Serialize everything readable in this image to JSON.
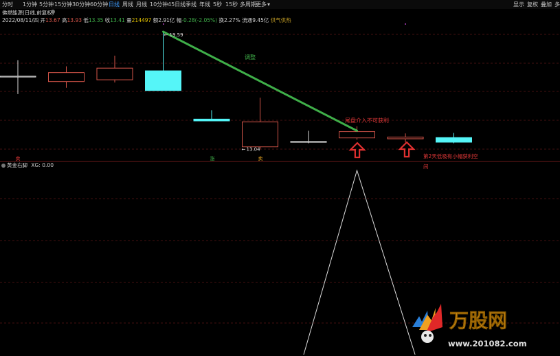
{
  "toolbar": {
    "periods": [
      {
        "label": "分时",
        "x": 3
      },
      {
        "label": "1分钟",
        "x": 33
      },
      {
        "label": "5分钟",
        "x": 57
      },
      {
        "label": "15分钟",
        "x": 79
      },
      {
        "label": "30分钟",
        "x": 105
      },
      {
        "label": "60分钟",
        "x": 131
      },
      {
        "label": "日线",
        "x": 158
      },
      {
        "label": "周线",
        "x": 178
      },
      {
        "label": "月线",
        "x": 198
      },
      {
        "label": "10分钟",
        "x": 218
      },
      {
        "label": "45日线",
        "x": 244
      },
      {
        "label": "季线",
        "x": 270
      },
      {
        "label": "年线",
        "x": 290
      },
      {
        "label": "5秒",
        "x": 310
      },
      {
        "label": "15秒",
        "x": 328
      },
      {
        "label": "多周期",
        "x": 349
      },
      {
        "label": "更多",
        "x": 372
      }
    ],
    "active_period": "日线",
    "dropdown_glyph": "▾",
    "right_items": [
      {
        "label": "显示",
        "x": 747
      },
      {
        "label": "复权",
        "x": 767
      },
      {
        "label": "叠加",
        "x": 787
      },
      {
        "label": "多",
        "x": 807
      }
    ]
  },
  "stock": {
    "name": "佛燃能源(日线,前复权)",
    "date": "2022/08/11/四",
    "open_label": "开",
    "open": "13.67",
    "high_label": "高",
    "high": "13.93",
    "low_label": "低",
    "low": "13.35",
    "close_label": "收",
    "close": "13.41",
    "volume_label": "量",
    "volume": "214497",
    "amount_label": "额",
    "amount": "2.91亿",
    "change_label": "幅",
    "change": "-0.28(-2.05%)",
    "turnover_label": "换",
    "turnover": "2.27%",
    "float_label": "流通",
    "float": "9.45亿",
    "concept": "供气供热"
  },
  "chart_data": {
    "type": "candlestick",
    "ylim": [
      12.6,
      19.9
    ],
    "candles": [
      {
        "o": 17.1,
        "h": 18.0,
        "l": 16.1,
        "c": 17.1,
        "color": "#dcdcdc",
        "fill": "none"
      },
      {
        "o": 16.8,
        "h": 17.65,
        "l": 16.45,
        "c": 17.3,
        "color": "#d8564a",
        "fill": "none"
      },
      {
        "o": 16.9,
        "h": 18.25,
        "l": 16.75,
        "c": 17.55,
        "color": "#d8564a",
        "fill": "none"
      },
      {
        "o": 17.4,
        "h": 19.59,
        "l": 16.3,
        "c": 16.3,
        "color": "#55f5f8",
        "fill": "#55f5f8"
      },
      {
        "o": 14.7,
        "h": 15.2,
        "l": 14.6,
        "c": 14.6,
        "color": "#55f5f8",
        "fill": "#55f5f8"
      },
      {
        "o": 13.15,
        "h": 15.9,
        "l": 13.04,
        "c": 14.55,
        "color": "#d8564a",
        "fill": "none"
      },
      {
        "o": 13.45,
        "h": 14.05,
        "l": 13.35,
        "c": 13.45,
        "color": "#dcdcdc",
        "fill": "none"
      },
      {
        "o": 13.65,
        "h": 14.3,
        "l": 13.55,
        "c": 14.0,
        "color": "#d8564a",
        "fill": "none"
      },
      {
        "o": 13.6,
        "h": 13.9,
        "l": 13.4,
        "c": 13.7,
        "color": "#d8564a",
        "fill": "none"
      },
      {
        "o": 13.67,
        "h": 13.93,
        "l": 13.35,
        "c": 13.41,
        "color": "#55f5f8",
        "fill": "#55f5f8"
      }
    ],
    "high_marker": "19.59",
    "low_marker": "13.04",
    "arrow_glyph": "←",
    "trend_line": {
      "from_candle": 3,
      "from_value": 19.59,
      "to_candle": 7,
      "to_value": 14.05,
      "color": "#3fae49"
    },
    "annotations": {
      "trend_note": "调整",
      "tail_note": "尾盘介入不可获利",
      "second_day_note_line1": "第2天低吸有小幅获利空",
      "second_day_note_line2": "间"
    },
    "signals": {
      "sell_1": "卖",
      "sell_2": "卖",
      "up": "涨"
    },
    "indicator": {
      "name": "黄金右脚",
      "label": "XG",
      "value": "0.00",
      "ylim": [
        0,
        1
      ],
      "peak_candle": 7,
      "peak_value": 1,
      "base_candles": [
        5.9,
        8.2
      ]
    }
  },
  "watermark": {
    "brand": "万股网",
    "url": "www.201082.com"
  },
  "colors": {
    "background": "#000000",
    "up": "#d8564a",
    "down": "#55f5f8",
    "annotation_red": "#e03838",
    "annotation_green": "#3fae49",
    "grid": "#5a1414",
    "active_tab": "#3c9cff"
  }
}
